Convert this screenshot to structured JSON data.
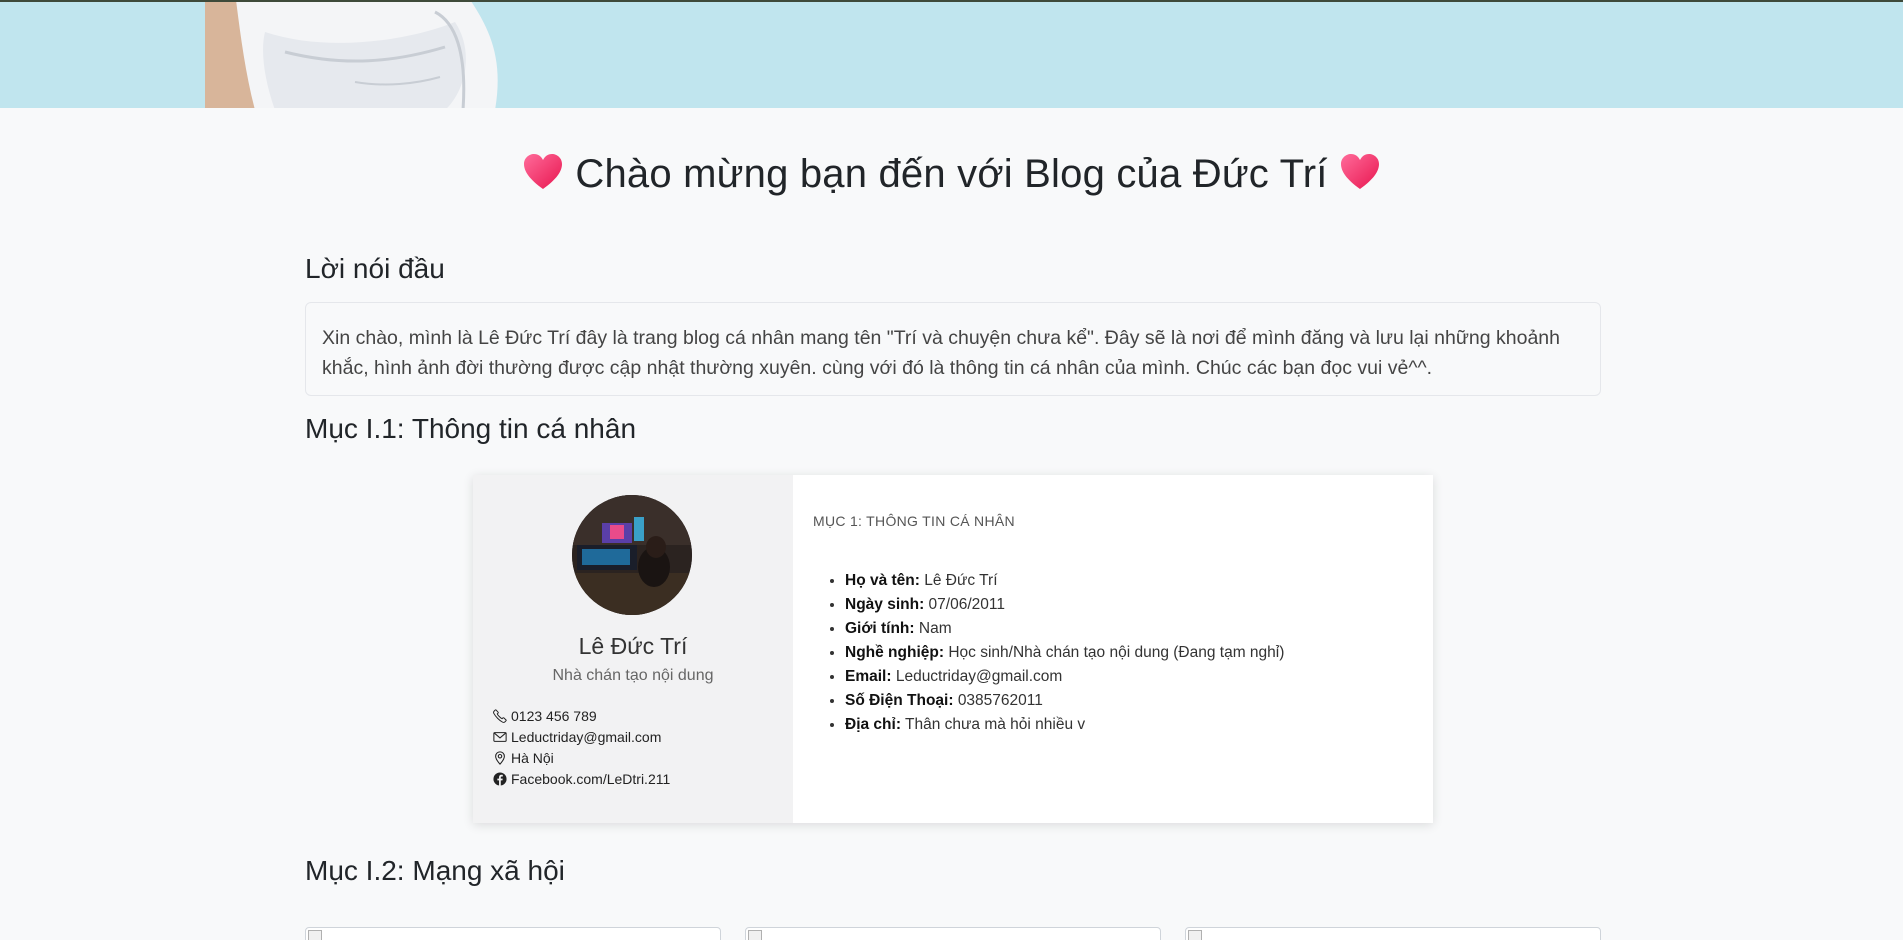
{
  "page": {
    "title": "Chào mừng bạn đến với Blog của Đức Trí",
    "title_icon": "heart-icon"
  },
  "intro": {
    "heading": "Lời nói đầu",
    "text": "Xin chào, mình là Lê Đức Trí đây là trang blog cá nhân mang tên \"Trí và chuyện chưa kể\". Đây sẽ là nơi để mình đăng và lưu lại những khoảnh khắc, hình ảnh đời thường được cập nhật thường xuyên. cùng với đó là thông tin cá nhân của mình. Chúc các bạn đọc vui vẻ^^."
  },
  "section1": {
    "heading": "Mục I.1: Thông tin cá nhân",
    "card": {
      "name": "Lê Đức Trí",
      "role": "Nhà chán tạo nội dung",
      "contacts": [
        {
          "icon": "phone-icon",
          "text": "0123 456 789"
        },
        {
          "icon": "envelope-icon",
          "text": "Leductriday@gmail.com"
        },
        {
          "icon": "location-pin-icon",
          "text": "Hà Nội"
        },
        {
          "icon": "facebook-icon",
          "text": "Facebook.com/LeDtri.211"
        }
      ],
      "section_label": "MỤC 1: THÔNG TIN CÁ NHÂN",
      "info": [
        {
          "label": "Họ và tên:",
          "value": "Lê Đức Trí"
        },
        {
          "label": "Ngày sinh:",
          "value": "07/06/2011"
        },
        {
          "label": "Giới tính:",
          "value": "Nam"
        },
        {
          "label": "Nghề nghiệp:",
          "value": "Học sinh/Nhà chán tạo nội dung (Đang tạm nghỉ)"
        },
        {
          "label": "Email:",
          "value": "Leductriday@gmail.com"
        },
        {
          "label": "Số Điện Thoại:",
          "value": "0385762011"
        },
        {
          "label": "Địa chỉ:",
          "value": "Thân chưa mà hỏi nhiều v"
        }
      ]
    }
  },
  "section2": {
    "heading": "Mục I.2: Mạng xã hội"
  },
  "colors": {
    "banner": "#c0e5ee",
    "background": "#f8f9fa",
    "heart": "#f0306a"
  }
}
